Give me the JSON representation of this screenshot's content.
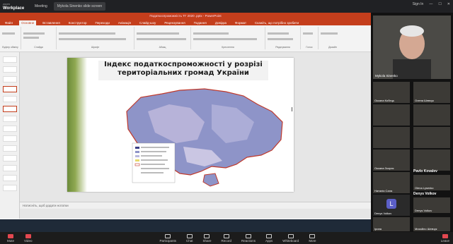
{
  "topbar": {
    "brand_small": "zoom",
    "brand_big": "Workplace",
    "tabs": [
      "Meeting",
      "Mykola Sinenko slide screen"
    ],
    "right_label": "Sign In"
  },
  "ppt": {
    "title": "Податкоспроможність ТГ 2020 .pptx - PowerPoint",
    "tabs": [
      "Файл",
      "Основне",
      "Вставлення",
      "Конструктор",
      "Переходи",
      "Анімація",
      "Слайд-шоу",
      "Рецензування",
      "Подання",
      "Довідка",
      "Формат",
      "Скажіть, що потрібно зробити"
    ],
    "ribbon_groups": [
      "Буфер обміну",
      "Слайди",
      "Шрифт",
      "Абзац",
      "Креслення",
      "Редагування",
      "Голос",
      "Дизайн"
    ],
    "notes_placeholder": "Натисніть, щоб додати нотатки",
    "status_left": "Слайд 1 з 1",
    "status_right": "82%"
  },
  "slide": {
    "title_line1": "Індекс податкоспроможності у розрізі",
    "title_line2": "територіальних громад України"
  },
  "participants": {
    "speaker_name": "Mykola Sinenko",
    "tiles": [
      "Оксана Кобець",
      "Олена Шевчук",
      "",
      "",
      "",
      "",
      "",
      "",
      "",
      "",
      "Оксана Зозуля",
      "",
      "Наталія Сала",
      "Pavlo Kovalev",
      "Olena Lysenko",
      "Denys Volkov",
      "Denys Volkov",
      "",
      "Ірина",
      "Михайло Шевчук"
    ],
    "name_pavlo": "Pavlo Kovalev",
    "name_denys": "Denys Volkov",
    "avatar_letter": "L"
  },
  "controls": [
    "Mute",
    "Video",
    "Participants",
    "Chat",
    "Share",
    "Record",
    "Reactions",
    "Apps",
    "Whiteboard",
    "More",
    "Leave"
  ]
}
